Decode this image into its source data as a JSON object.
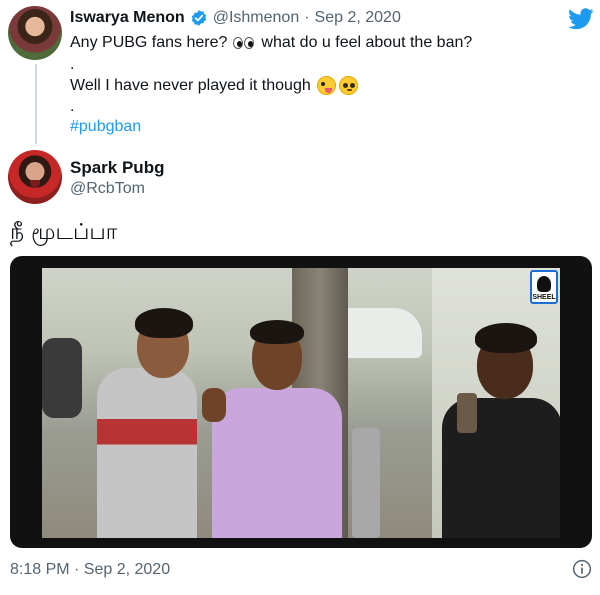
{
  "parent_tweet": {
    "author_name": "Iswarya Menon",
    "handle": "@Ishmenon",
    "separator": "·",
    "date": "Sep 2, 2020",
    "line_1": "Any PUBG fans here?",
    "line_1_emoji": "eyes-icon",
    "line_1_rest": "what do u feel about the ban?",
    "dot_1": ".",
    "line_2": "Well I have never played it though",
    "line_2_emojis": [
      "zany-face-icon",
      "pleading-face-icon"
    ],
    "dot_2": ".",
    "hashtag": "#pubgban"
  },
  "reply_tweet": {
    "author_name": "Spark Pubg",
    "handle": "@RcbTom",
    "text": "நீ மூடப்பா"
  },
  "media": {
    "type": "video",
    "watermark": "SHEEL"
  },
  "footer": {
    "timestamp": "8:18 PM · Sep 2, 2020"
  },
  "colors": {
    "link": "#1d9bf0",
    "secondary_text": "#536471",
    "twitter_blue": "#1d9bf0"
  }
}
